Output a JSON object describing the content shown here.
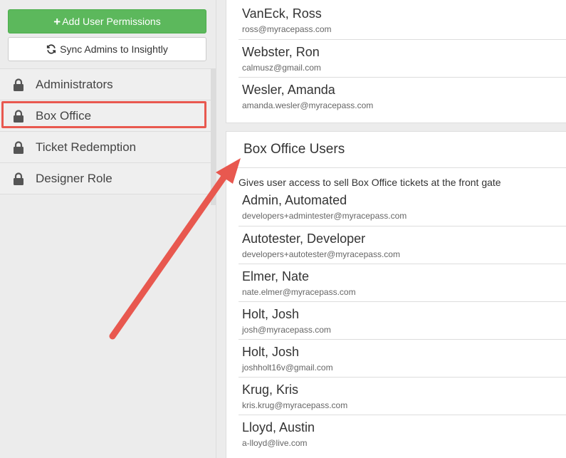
{
  "sidebar": {
    "add_button_label": "Add User Permissions",
    "sync_button_label": "Sync Admins to Insightly",
    "roles": [
      {
        "label": "Administrators"
      },
      {
        "label": "Box Office"
      },
      {
        "label": "Ticket Redemption"
      },
      {
        "label": "Designer Role"
      }
    ],
    "highlighted_role": "Box Office"
  },
  "admin_users": [
    {
      "name": "VanEck, Ross",
      "email": "ross@myracepass.com"
    },
    {
      "name": "Webster, Ron",
      "email": "calmusz@gmail.com"
    },
    {
      "name": "Wesler, Amanda",
      "email": "amanda.wesler@myracepass.com"
    }
  ],
  "box_office": {
    "title": "Box Office Users",
    "description": "Gives user access to sell Box Office tickets at the front gate",
    "users": [
      {
        "name": "Admin, Automated",
        "email": "developers+admintester@myracepass.com"
      },
      {
        "name": "Autotester, Developer",
        "email": "developers+autotester@myracepass.com"
      },
      {
        "name": "Elmer, Nate",
        "email": "nate.elmer@myracepass.com"
      },
      {
        "name": "Holt, Josh",
        "email": "josh@myracepass.com"
      },
      {
        "name": "Holt, Josh",
        "email": "joshholt16v@gmail.com"
      },
      {
        "name": "Krug, Kris",
        "email": "kris.krug@myracepass.com"
      },
      {
        "name": "Lloyd, Austin",
        "email": "a-lloyd@live.com"
      }
    ]
  },
  "colors": {
    "add_button": "#5cb85c",
    "highlight": "#e8584f",
    "arrow": "#e8584f"
  },
  "icons": [
    "plus-icon",
    "sync-icon",
    "lock-icon"
  ]
}
